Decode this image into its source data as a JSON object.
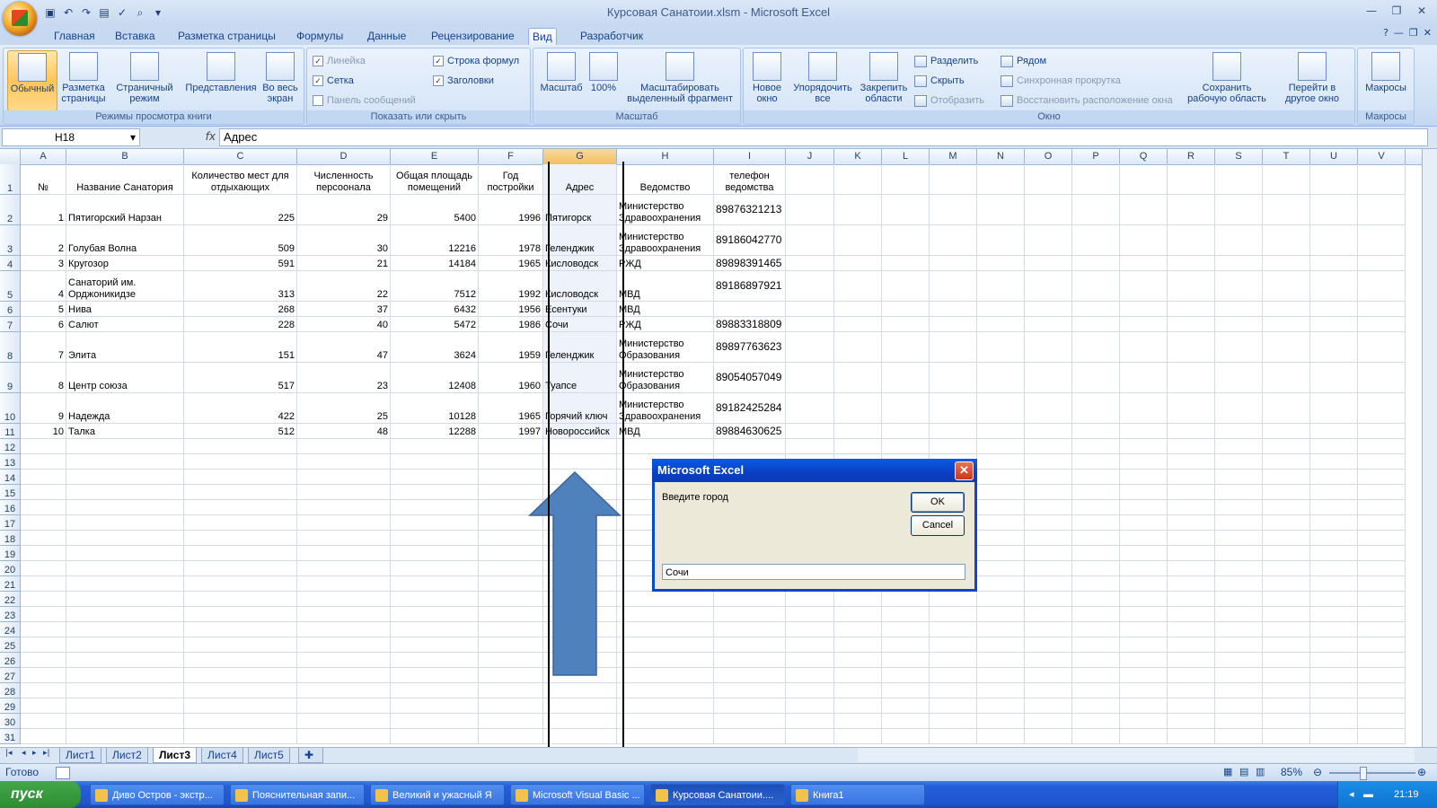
{
  "window": {
    "title": "Курсовая Санатоии.xlsm - Microsoft Excel"
  },
  "ribbon_tabs": [
    "Главная",
    "Вставка",
    "Разметка страницы",
    "Формулы",
    "Данные",
    "Рецензирование",
    "Вид",
    "Разработчик"
  ],
  "ribbon": {
    "group1": {
      "label": "Режимы просмотра книги",
      "buttons": [
        "Обычный",
        "Разметка страницы",
        "Страничный режим",
        "Представления",
        "Во весь экран"
      ]
    },
    "group2": {
      "label": "Показать или скрыть",
      "items": [
        "Линейка",
        "Сетка",
        "Панель сообщений",
        "Строка формул",
        "Заголовки"
      ]
    },
    "group3": {
      "label": "Масштаб",
      "buttons": [
        "Масштаб",
        "100%",
        "Масштабировать выделенный фрагмент"
      ]
    },
    "group4": {
      "label": "Окно",
      "buttons": [
        "Новое окно",
        "Упорядочить все",
        "Закрепить области"
      ],
      "small": [
        "Разделить",
        "Скрыть",
        "Отобразить",
        "Рядом",
        "Синхронная прокрутка",
        "Восстановить расположение окна"
      ],
      "big2": [
        "Сохранить рабочую область",
        "Перейти в другое окно"
      ]
    },
    "group5": {
      "label": "Макросы",
      "buttons": [
        "Макросы"
      ]
    }
  },
  "formula_bar": {
    "name_box": "H18",
    "fx": "fx",
    "content": "Адрес"
  },
  "columns": [
    "A",
    "B",
    "C",
    "D",
    "E",
    "F",
    "G",
    "H",
    "I",
    "J",
    "K",
    "L",
    "M",
    "N",
    "O",
    "P",
    "Q",
    "R",
    "S",
    "T",
    "U",
    "V"
  ],
  "headers": [
    "№",
    "Название Санатория",
    "Количество мест для отдыхающих",
    "Численность персоонала",
    "Общая площадь помещений",
    "Год постройки",
    "Адрес",
    "Ведомство",
    "телефон ведомства"
  ],
  "rows": [
    [
      "1",
      "Пятигорский Нарзан",
      "225",
      "29",
      "5400",
      "1996",
      "Пятигорск",
      "Министерство Здравоохранения",
      "89876321213"
    ],
    [
      "2",
      "Голубая Волна",
      "509",
      "30",
      "12216",
      "1978",
      "Геленджик",
      "Министерство Здравоохранения",
      "89186042770"
    ],
    [
      "3",
      "Кругозор",
      "591",
      "21",
      "14184",
      "1965",
      "Кисловодск",
      "РЖД",
      "89898391465"
    ],
    [
      "4",
      "Санаторий им. Орджоникидзе",
      "313",
      "22",
      "7512",
      "1992",
      "Кисловодск",
      "МВД",
      "89186897921"
    ],
    [
      "5",
      "Нива",
      "268",
      "37",
      "6432",
      "1956",
      "Есентуки",
      "МВД",
      ""
    ],
    [
      "6",
      "Салют",
      "228",
      "40",
      "5472",
      "1986",
      "Сочи",
      "РЖД",
      "89883318809"
    ],
    [
      "7",
      "Элита",
      "151",
      "47",
      "3624",
      "1959",
      "Геленджик",
      "Министерство Образования",
      "89897763623"
    ],
    [
      "8",
      "Центр союза",
      "517",
      "23",
      "12408",
      "1960",
      "Туапсе",
      "Министерство Образования",
      "89054057049"
    ],
    [
      "9",
      "Надежда",
      "422",
      "25",
      "10128",
      "1965",
      "Горячий ключ",
      "Министерство Здравоохранения",
      "89182425284"
    ],
    [
      "10",
      "Талка",
      "512",
      "48",
      "12288",
      "1997",
      "Новороссийск",
      "МВД",
      "89884630625"
    ]
  ],
  "row_numbers": [
    "1",
    "2",
    "3",
    "4",
    "5",
    "6",
    "7",
    "8",
    "9",
    "10",
    "11",
    "12",
    "13",
    "14",
    "15",
    "16",
    "17",
    "18",
    "19",
    "20",
    "21",
    "22",
    "23",
    "24",
    "25",
    "26",
    "27",
    "28",
    "29",
    "30",
    "31"
  ],
  "sheets": [
    "Лист1",
    "Лист2",
    "Лист3",
    "Лист4",
    "Лист5"
  ],
  "active_sheet": "Лист3",
  "status": {
    "ready": "Готово",
    "zoom": "85%"
  },
  "dialog": {
    "title": "Microsoft Excel",
    "prompt": "Введите город",
    "ok": "OK",
    "cancel": "Cancel",
    "input_value": "Сочи"
  },
  "taskbar": {
    "start": "пуск",
    "tasks": [
      "Диво Остров - экстр...",
      "Пояснительная запи...",
      "Великий и ужасный Я",
      "Microsoft Visual Basic ...",
      "Курсовая Санатоии....",
      "Книга1"
    ],
    "clock": "21:19"
  },
  "colors": {
    "accent": "#4f81bd",
    "dialog_title": "#0a49c9",
    "selection": "#f1c15f"
  }
}
